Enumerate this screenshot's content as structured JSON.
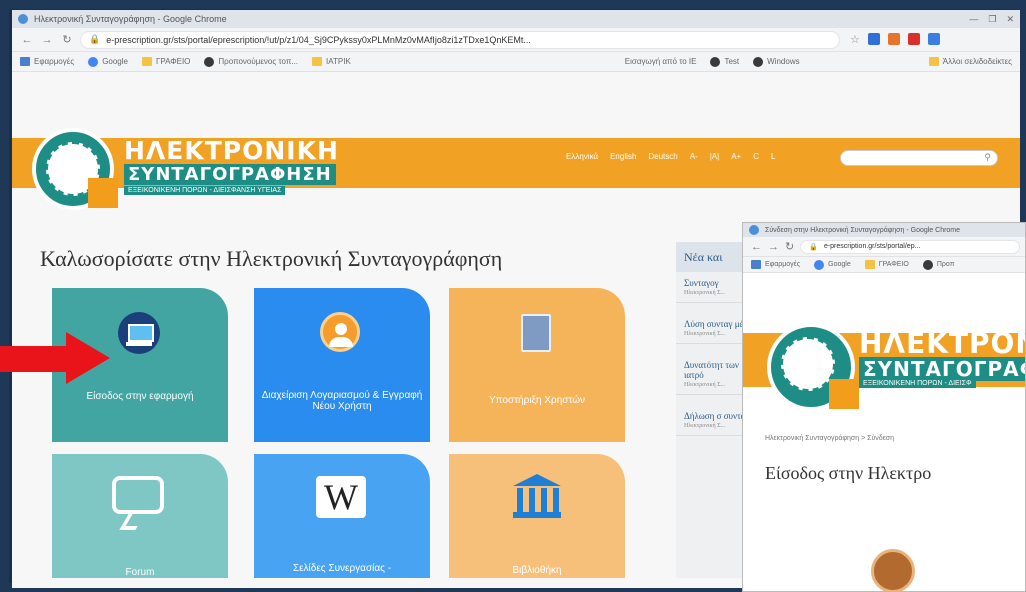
{
  "browser": {
    "title": "Ηλεκτρονική Συνταγογράφηση - Google Chrome",
    "url": "e-prescription.gr/sts/portal/eprescription/!ut/p/z1/04_Sj9CPykssy0xPLMnMz0vMAfIjo8zi1zTDxe1QnKEMt...",
    "bookmarks": [
      "Εφαρμογές",
      "Google",
      "ΓΡΑΦΕΙΟ",
      "Προπονούμενος τοπ...",
      "ΙΑΤΡΙΚ",
      "Εισαγωγή από το IE",
      "Test",
      "Windows",
      "Άλλοι σελιδοδείκτες"
    ]
  },
  "site": {
    "logo_title": "ΗΛΕΚΤΡΟΝΙΚΗ",
    "logo_sub": "ΣΥΝΤΑΓΟΓΡΑΦΗΣΗ",
    "logo_tag": "ΕΞΕΙΚΟΝΙΚΕΝΗ ΠΟΡΩΝ - ΔΙΕΙΣΦΑΝΣΗ ΥΓΕΙΑΣ",
    "lang_links": [
      "Ελληνικά",
      "English",
      "Deutsch",
      "A-",
      "|A|",
      "A+",
      "C",
      "L"
    ],
    "welcome": "Καλωσορίσατε στην Ηλεκτρονική Συνταγογράφηση"
  },
  "tiles": [
    {
      "label": "Είσοδος στην εφαρμογή"
    },
    {
      "label": "Διαχείριση Λογαριασμού & Εγγραφή Νέου Χρήστη"
    },
    {
      "label": "Υποστήριξη Χρηστών"
    },
    {
      "label": "Forum"
    },
    {
      "label": "Σελίδες Συνεργασίας -"
    },
    {
      "label": "Βιβλιοθήκη"
    }
  ],
  "news": {
    "header": "Νέα και",
    "items": [
      {
        "title": "Συνταγογ",
        "date": "Ηλεκτρονική Σ..."
      },
      {
        "title": "Λύση συνταγ μέλη",
        "date": "Ηλεκτρονική Σ..."
      },
      {
        "title": "Δυνατότητ των ιατρό",
        "date": "Ηλεκτρονική Σ..."
      },
      {
        "title": "Δήλωση σ συνταγογ",
        "date": "Ηλεκτρονική Σ..."
      }
    ]
  },
  "second_window": {
    "title": "Σύνδεση στην Ηλεκτρονική Συνταγογράφηση - Google Chrome",
    "url": "e-prescription.gr/sts/portal/ep...",
    "bookmarks": [
      "Εφαρμογές",
      "Google",
      "ΓΡΑΦΕΙΟ",
      "Προπ"
    ],
    "logo_title": "ΗΛΕΚΤΡΟΝ",
    "logo_sub": "ΣΥΝΤΑΓΟΓΡΑΦ",
    "logo_tag": "ΕΞΕΙΚΟΝΙΚΕΝΗ ΠΟΡΩΝ - ΔΙΕΙΣΦ",
    "breadcrumb": "Ηλεκτρονική Συνταγογράφηση > Σύνδεση",
    "login_title": "Είσοδος στην Ηλεκτρο"
  }
}
